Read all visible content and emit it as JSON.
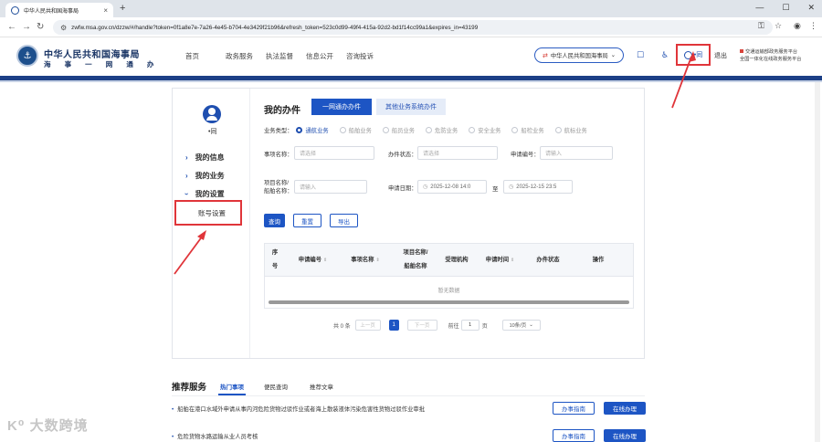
{
  "browser": {
    "tab_title": "中华人民共和国海事局",
    "tab_close": "×",
    "new_tab": "+",
    "win_min": "—",
    "win_max": "☐",
    "win_close": "✕",
    "back": "←",
    "forward": "→",
    "reload": "↻",
    "url": "zwfw.msa.gov.cn/dzzw/#/handle?token=0f1a8e7e-7a26-4e45-b704-4e3429f21b96&refresh_token=523c0d99-49f4-415a-92d2-bd1f14cc99a1&expires_in=43199"
  },
  "header": {
    "logo_title": "中华人民共和国海事局",
    "logo_subtitle": "海 事 一 网 通 办",
    "nav": [
      "首页",
      "政务服务",
      "执法监督",
      "信息公开",
      "咨询投诉"
    ],
    "dept_select": "中华人民共和国海事局",
    "user_name": "•同",
    "logout": "退出",
    "link1": "交通运输部政务服务平台",
    "link2": "全国一体化在线政务服务平台"
  },
  "sidebar": {
    "user_name": "•同",
    "items": [
      {
        "label": "我的信息"
      },
      {
        "label": "我的业务"
      },
      {
        "label": "我的设置"
      }
    ],
    "sub_item": "账号设置"
  },
  "main": {
    "title": "我的办件",
    "tabs": [
      "一网通办办件",
      "其他业务系统办件"
    ],
    "biz_type_label": "业务类型：",
    "biz_types": [
      {
        "label": "通航业务",
        "checked": true
      },
      {
        "label": "船舶业务",
        "checked": false
      },
      {
        "label": "船员业务",
        "checked": false
      },
      {
        "label": "危防业务",
        "checked": false
      },
      {
        "label": "安全业务",
        "checked": false
      },
      {
        "label": "船检业务",
        "checked": false
      },
      {
        "label": "航标业务",
        "checked": false
      }
    ],
    "item_name_label": "事项名称：",
    "item_name_placeholder": "请选择",
    "status_label": "办件状态：",
    "status_placeholder": "请选择",
    "apply_no_label": "申请编号：",
    "apply_no_placeholder": "请输入",
    "project_label_1": "项目名称/",
    "project_label_2": "船舶名称：",
    "project_placeholder": "请输入",
    "date_label": "申请日期：",
    "date_start": "2025-12-08 14:0",
    "date_sep": "至",
    "date_end": "2025-12-15 23:5",
    "btn_query": "查询",
    "btn_reset": "重置",
    "btn_export": "导出",
    "table": {
      "headers": [
        {
          "line1": "序",
          "line2": "号"
        },
        {
          "line1": "申请编号",
          "line2": ""
        },
        {
          "line1": "事项名称",
          "line2": ""
        },
        {
          "line1": "项目名称/",
          "line2": "船舶名称"
        },
        {
          "line1": "受理机构",
          "line2": ""
        },
        {
          "line1": "申请时间",
          "line2": ""
        },
        {
          "line1": "办件状态",
          "line2": ""
        },
        {
          "line1": "操作",
          "line2": ""
        }
      ],
      "empty_text": "暂无数据"
    },
    "pager": {
      "total": "共 0 条",
      "prev": "上一页",
      "current": "1",
      "next": "下一页",
      "goto_prefix": "前往",
      "goto_value": "1",
      "goto_suffix": "页",
      "page_size": "10条/页"
    }
  },
  "recommend": {
    "title": "推荐服务",
    "tabs": [
      "热门事项",
      "便民查询",
      "推荐文章"
    ],
    "items": [
      {
        "text": "船舶在港口水域外申请从事内河危险货物过驳作业或者海上散装液体污染危害性货物过驳作业审批",
        "guide": "办事指南",
        "apply": "在线办理"
      },
      {
        "text": "危险货物水路运输从业人员考核",
        "guide": "办事指南",
        "apply": "在线办理"
      }
    ]
  },
  "watermark": "大数跨境",
  "colors": {
    "primary": "#1d55c4",
    "header_stripe": "#1c3f86",
    "highlight": "#e0353a"
  }
}
